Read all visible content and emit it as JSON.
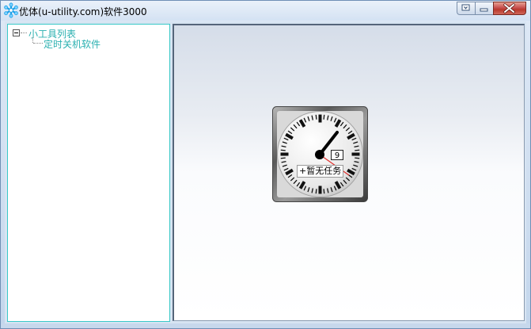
{
  "window": {
    "title": "优体(u-utility.com)软件3000"
  },
  "sidebar": {
    "tree": {
      "root": {
        "label": "小工具列表",
        "expanded": true
      },
      "children": [
        {
          "label": "定时关机软件"
        }
      ]
    }
  },
  "clock": {
    "date_value": "9",
    "task_text": "+暂无任务"
  },
  "colors": {
    "tree_text": "#2ab0b0",
    "tree_border": "#39c8c8",
    "second_hand": "#e0302c",
    "close_button": "#c75050"
  },
  "icons": {
    "app": "snowflake-icon",
    "titlebar_buttons": [
      "menu-icon",
      "minimize-icon",
      "close-icon"
    ]
  }
}
